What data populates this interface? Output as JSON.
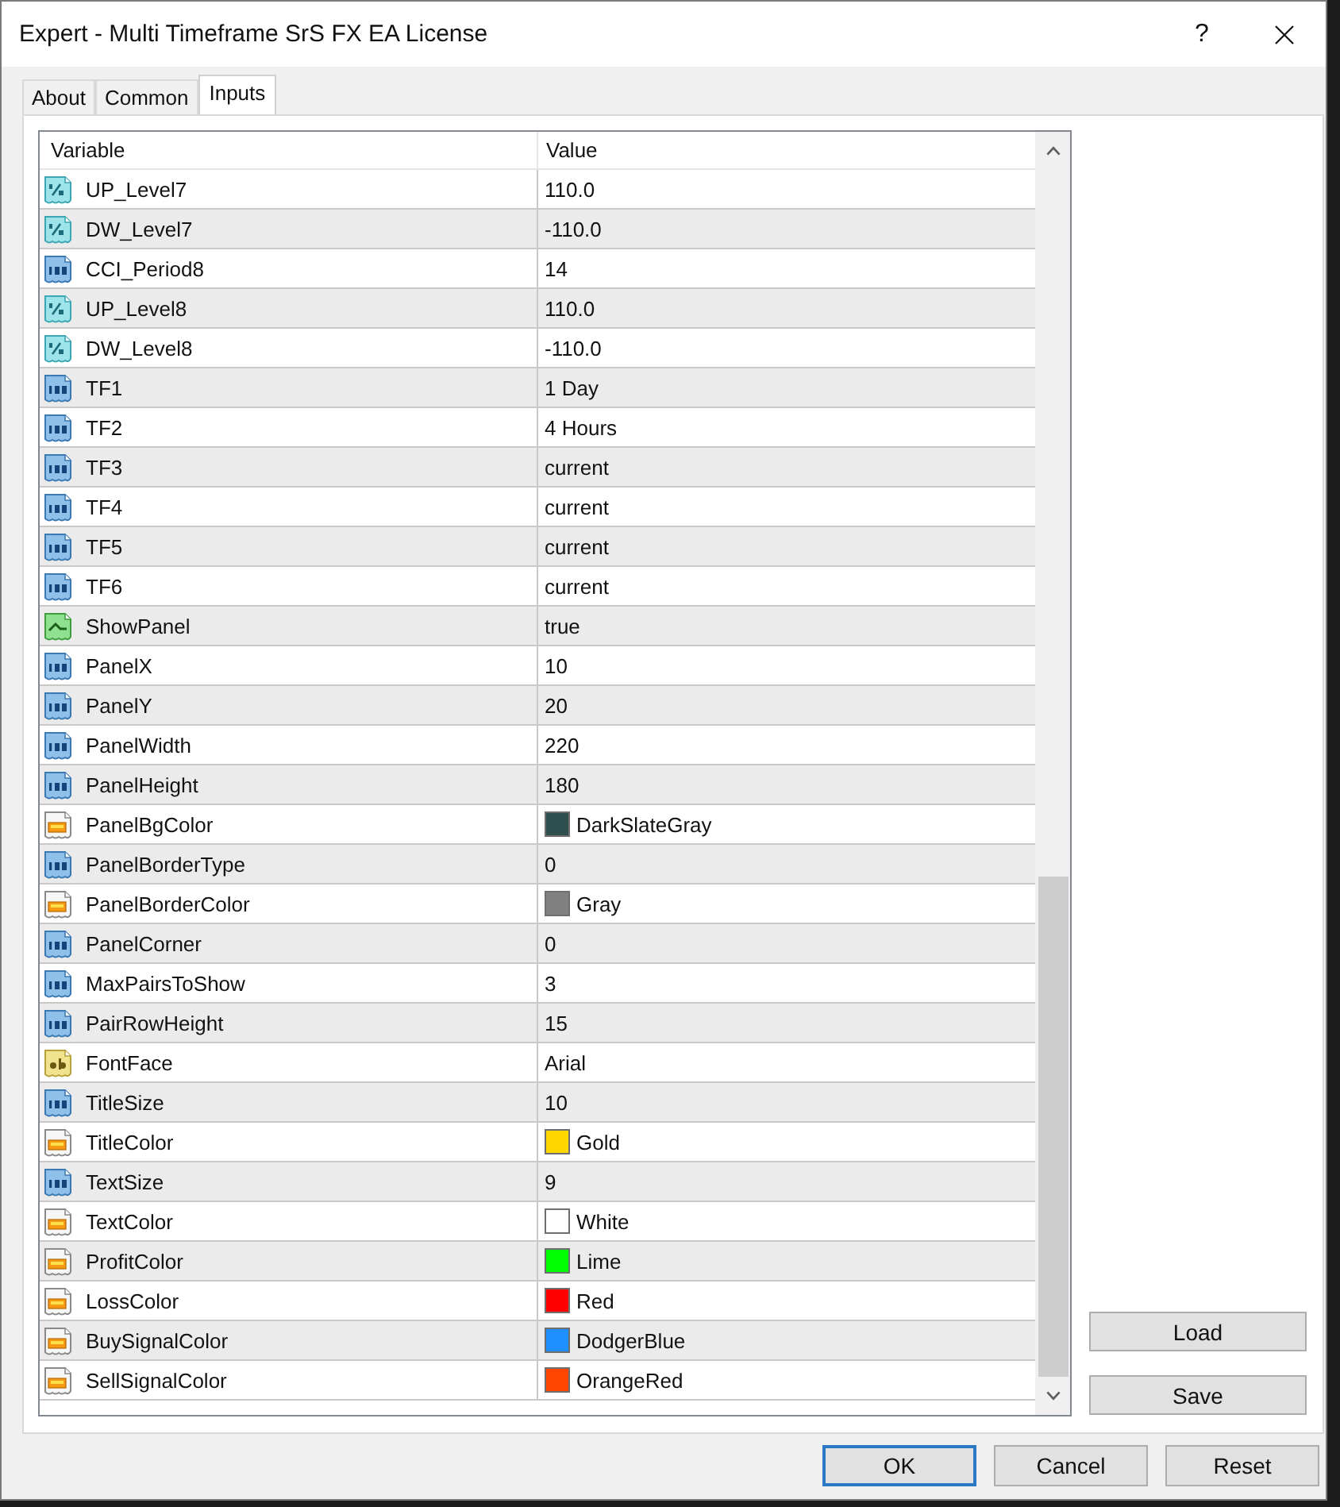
{
  "window": {
    "title": "Expert - Multi Timeframe SrS FX EA License",
    "help_label": "?"
  },
  "tabs": [
    {
      "label": "About",
      "selected": false
    },
    {
      "label": "Common",
      "selected": false
    },
    {
      "label": "Inputs",
      "selected": true
    }
  ],
  "table": {
    "columns": [
      "Variable",
      "Value"
    ],
    "rows": [
      {
        "kind": "double",
        "name": "UP_Level7",
        "value": "110.0"
      },
      {
        "kind": "double",
        "name": "DW_Level7",
        "value": "-110.0"
      },
      {
        "kind": "int",
        "name": "CCI_Period8",
        "value": "14"
      },
      {
        "kind": "double",
        "name": "UP_Level8",
        "value": "110.0"
      },
      {
        "kind": "double",
        "name": "DW_Level8",
        "value": "-110.0"
      },
      {
        "kind": "int",
        "name": "TF1",
        "value": "1 Day"
      },
      {
        "kind": "int",
        "name": "TF2",
        "value": "4 Hours"
      },
      {
        "kind": "int",
        "name": "TF3",
        "value": "current"
      },
      {
        "kind": "int",
        "name": "TF4",
        "value": "current"
      },
      {
        "kind": "int",
        "name": "TF5",
        "value": "current"
      },
      {
        "kind": "int",
        "name": "TF6",
        "value": "current"
      },
      {
        "kind": "bool",
        "name": "ShowPanel",
        "value": "true"
      },
      {
        "kind": "int",
        "name": "PanelX",
        "value": "10"
      },
      {
        "kind": "int",
        "name": "PanelY",
        "value": "20"
      },
      {
        "kind": "int",
        "name": "PanelWidth",
        "value": "220"
      },
      {
        "kind": "int",
        "name": "PanelHeight",
        "value": "180"
      },
      {
        "kind": "color",
        "name": "PanelBgColor",
        "value": "DarkSlateGray",
        "color": "#2f4f4f"
      },
      {
        "kind": "int",
        "name": "PanelBorderType",
        "value": "0"
      },
      {
        "kind": "color",
        "name": "PanelBorderColor",
        "value": "Gray",
        "color": "#808080"
      },
      {
        "kind": "int",
        "name": "PanelCorner",
        "value": "0"
      },
      {
        "kind": "int",
        "name": "MaxPairsToShow",
        "value": "3"
      },
      {
        "kind": "int",
        "name": "PairRowHeight",
        "value": "15"
      },
      {
        "kind": "string",
        "name": "FontFace",
        "value": "Arial"
      },
      {
        "kind": "int",
        "name": "TitleSize",
        "value": "10"
      },
      {
        "kind": "color",
        "name": "TitleColor",
        "value": "Gold",
        "color": "#ffd700"
      },
      {
        "kind": "int",
        "name": "TextSize",
        "value": "9"
      },
      {
        "kind": "color",
        "name": "TextColor",
        "value": "White",
        "color": "#ffffff"
      },
      {
        "kind": "color",
        "name": "ProfitColor",
        "value": "Lime",
        "color": "#00ff00"
      },
      {
        "kind": "color",
        "name": "LossColor",
        "value": "Red",
        "color": "#ff0000"
      },
      {
        "kind": "color",
        "name": "BuySignalColor",
        "value": "DodgerBlue",
        "color": "#1e90ff"
      },
      {
        "kind": "color",
        "name": "SellSignalColor",
        "value": "OrangeRed",
        "color": "#ff4500"
      }
    ]
  },
  "side_buttons": [
    "Load",
    "Save"
  ],
  "footer_buttons": [
    {
      "label": "OK",
      "default": true
    },
    {
      "label": "Cancel",
      "default": false
    },
    {
      "label": "Reset",
      "default": false
    }
  ]
}
